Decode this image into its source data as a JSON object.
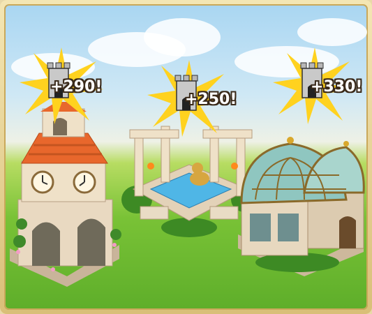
{
  "rewards": [
    {
      "id": "clock-tower",
      "bonus_label": "+290!"
    },
    {
      "id": "fountain",
      "bonus_label": "+250!"
    },
    {
      "id": "greenhouse",
      "bonus_label": "+330!"
    }
  ],
  "icons": {
    "bonus_icon": "castle-tower-icon",
    "burst": "sparkle-burst-icon"
  },
  "colors": {
    "frame": "#d9bf78",
    "grass": "#5eae2a",
    "sky": "#a9d6f2",
    "burst": "#ffd21f",
    "roof": "#e8672c",
    "stone": "#e8d8c0",
    "glass": "#8fc6c0"
  }
}
